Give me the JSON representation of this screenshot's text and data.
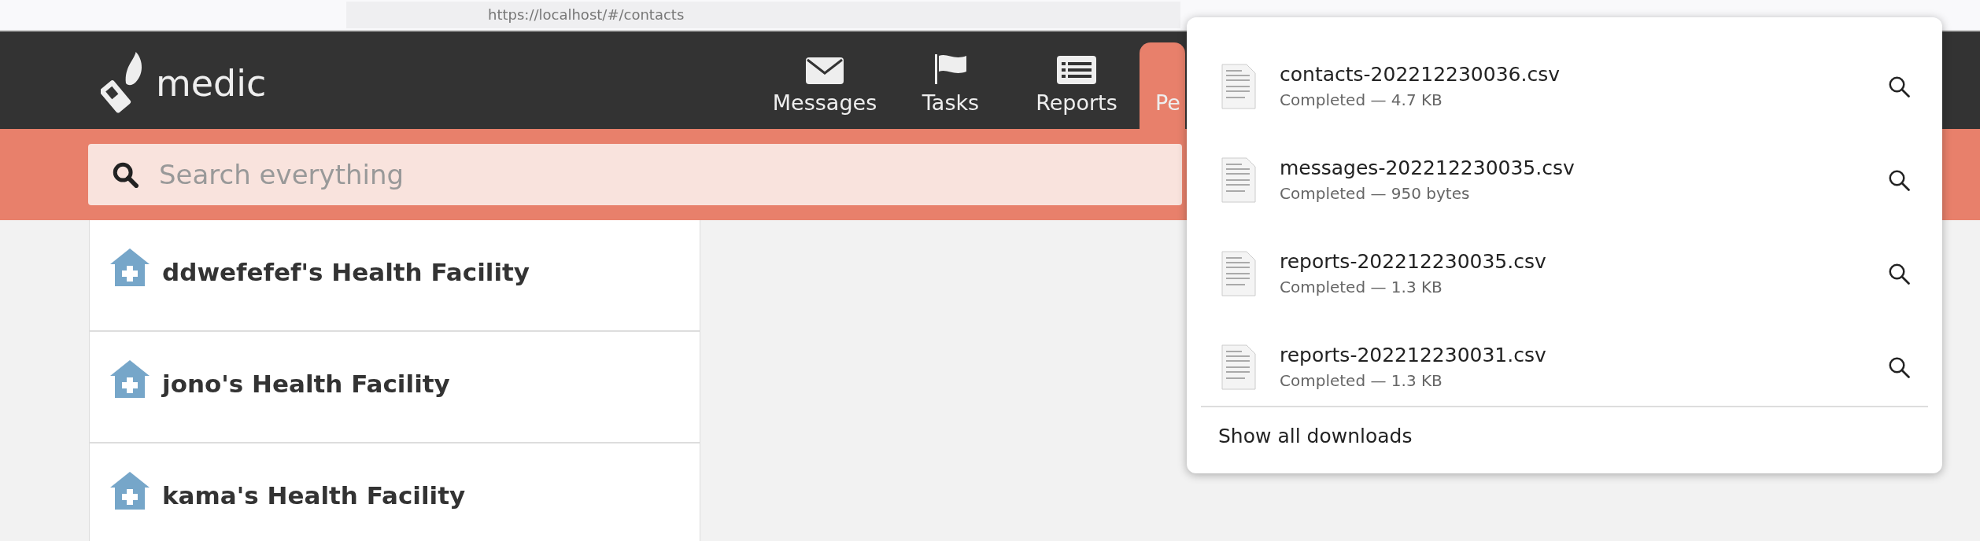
{
  "browser": {
    "address": "https://localhost/#/contacts"
  },
  "header": {
    "logo": "medic",
    "tabs": [
      {
        "label": "Messages",
        "selected": false
      },
      {
        "label": "Tasks",
        "selected": false
      },
      {
        "label": "Reports",
        "selected": false
      },
      {
        "label": "Pe",
        "selected": true
      }
    ]
  },
  "search": {
    "placeholder": "Search everything"
  },
  "contacts": [
    {
      "name": "ddwefefef's Health Facility"
    },
    {
      "name": "jono's Health Facility"
    },
    {
      "name": "kama's Health Facility"
    }
  ],
  "downloads": {
    "items": [
      {
        "file": "contacts-202212230036.csv",
        "status": "Completed — 4.7 KB"
      },
      {
        "file": "messages-202212230035.csv",
        "status": "Completed — 950 bytes"
      },
      {
        "file": "reports-202212230035.csv",
        "status": "Completed — 1.3 KB"
      },
      {
        "file": "reports-202212230031.csv",
        "status": "Completed — 1.3 KB"
      }
    ],
    "footer": "Show all downloads"
  }
}
